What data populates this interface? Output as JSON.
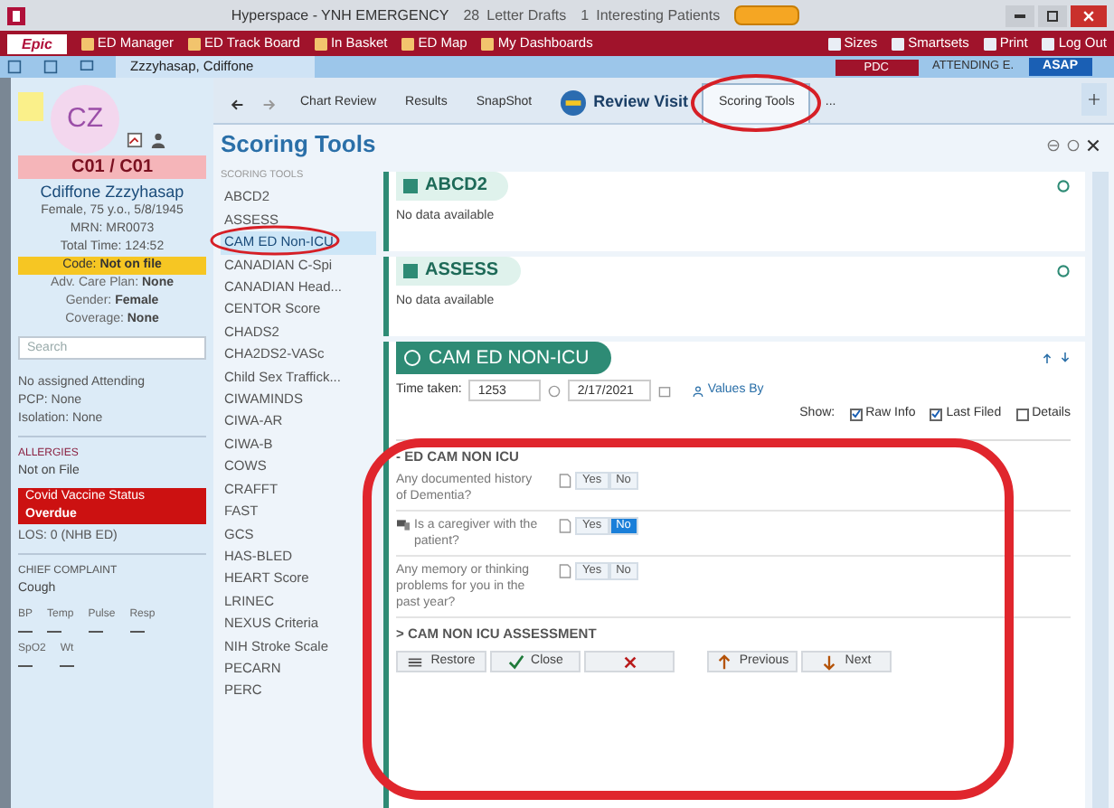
{
  "window": {
    "title": "Hyperspace - YNH EMERGENCY",
    "notices": [
      {
        "count": "28",
        "label": "Letter Drafts"
      },
      {
        "count": "1",
        "label": "Interesting Patients"
      }
    ]
  },
  "toolbar": {
    "logo": "Epic",
    "items": [
      "ED Manager",
      "ED Track Board",
      "In Basket",
      "ED Map",
      "My Dashboards"
    ],
    "right_items": [
      "Sizes",
      "Smartsets",
      "Print",
      "Log Out"
    ]
  },
  "patient_tab": {
    "label": "Zzzyhasap, Cdiffone",
    "badge": "PDC",
    "role": "ATTENDING E.",
    "priority": "ASAP"
  },
  "patient": {
    "initials": "CZ",
    "bed": "C01 / C01",
    "name": "Cdiffone Zzzyhasap",
    "details": [
      "Female, 75 y.o., 5/8/1945",
      "MRN: MR0073",
      "Total Time: 124:52"
    ],
    "code": {
      "label": "Code:",
      "value": "Not on file"
    },
    "facts": [
      {
        "label": "Adv. Care Plan:",
        "value": "None"
      },
      {
        "label": "Gender:",
        "value": "Female"
      },
      {
        "label": "Coverage:",
        "value": "None"
      }
    ],
    "search_placeholder": "Search",
    "care": [
      "No assigned Attending",
      "PCP: None",
      "Isolation: None"
    ],
    "allergies": {
      "title": "ALLERGIES",
      "value": "Not on File"
    },
    "alert": {
      "title": "Covid Vaccine Status",
      "value": "Overdue"
    },
    "los": "LOS: 0 (NHB ED)",
    "complaint": {
      "title": "CHIEF COMPLAINT",
      "value": "Cough"
    },
    "vitals": [
      [
        "BP",
        "Temp",
        "Pulse",
        "Resp"
      ],
      [
        "SpO2",
        "Wt"
      ]
    ]
  },
  "nav_tabs": [
    {
      "label": "Chart Review",
      "selected": false
    },
    {
      "label": "Results",
      "selected": false
    },
    {
      "label": "SnapShot",
      "selected": false
    },
    {
      "label": "Review Visit",
      "selected": false,
      "kind": "big"
    },
    {
      "label": "Scoring Tools",
      "selected": true
    },
    {
      "label": "...",
      "selected": false
    }
  ],
  "scoring": {
    "title": "Scoring Tools",
    "list_heading": "SCORING TOOLS",
    "tools": [
      {
        "label": "ABCD2",
        "selected": false
      },
      {
        "label": "ASSESS",
        "selected": false
      },
      {
        "label": "CAM ED Non-ICU",
        "selected": true
      },
      {
        "label": "CANADIAN C-Spi",
        "selected": false
      },
      {
        "label": "CANADIAN Head...",
        "selected": false
      },
      {
        "label": "CENTOR Score",
        "selected": false
      },
      {
        "label": "CHADS2",
        "selected": false
      },
      {
        "label": "CHA2DS2-VASc",
        "selected": false
      },
      {
        "label": "Child Sex Traffick...",
        "selected": false
      },
      {
        "label": "CIWAMINDS",
        "selected": false
      },
      {
        "label": "CIWA-AR",
        "selected": false
      },
      {
        "label": "CIWA-B",
        "selected": false
      },
      {
        "label": "COWS",
        "selected": false
      },
      {
        "label": "CRAFFT",
        "selected": false
      },
      {
        "label": "FAST",
        "selected": false
      },
      {
        "label": "GCS",
        "selected": false
      },
      {
        "label": "HAS-BLED",
        "selected": false
      },
      {
        "label": "HEART Score",
        "selected": false
      },
      {
        "label": "LRINEC",
        "selected": false
      },
      {
        "label": "NEXUS Criteria",
        "selected": false
      },
      {
        "label": "NIH Stroke Scale",
        "selected": false
      },
      {
        "label": "PECARN",
        "selected": false
      },
      {
        "label": "PERC",
        "selected": false
      }
    ],
    "cards": [
      {
        "title": "ABCD2",
        "message": "No data available"
      },
      {
        "title": "ASSESS",
        "message": "No data available"
      }
    ],
    "form": {
      "title": "CAM ED NON-ICU",
      "time_label": "Time taken:",
      "time": "1253",
      "date": "2/17/2021",
      "values_by": "Values By",
      "show_label": "Show:",
      "options": [
        {
          "label": "Raw Info",
          "checked": true
        },
        {
          "label": "Last Filed",
          "checked": true
        },
        {
          "label": "Details",
          "checked": false
        }
      ],
      "section": "- ED CAM NON ICU",
      "questions": [
        {
          "text": "Any documented history of Dementia?",
          "answers": [
            {
              "label": "Yes",
              "selected": false
            },
            {
              "label": "No",
              "selected": false
            }
          ],
          "commented": false
        },
        {
          "text": "Is a caregiver with the patient?",
          "answers": [
            {
              "label": "Yes",
              "selected": false
            },
            {
              "label": "No",
              "selected": true
            }
          ],
          "commented": true
        },
        {
          "text": "Any memory or thinking problems for you in the past year?",
          "answers": [
            {
              "label": "Yes",
              "selected": false
            },
            {
              "label": "No",
              "selected": false
            }
          ],
          "commented": false
        }
      ],
      "collapsed_section": "> CAM NON ICU ASSESSMENT",
      "buttons": [
        {
          "label": "Restore",
          "kind": "restore"
        },
        {
          "label": "Close",
          "kind": "close"
        },
        {
          "kind": "cancel"
        },
        {
          "label": "Previous",
          "kind": "previous"
        },
        {
          "label": "Next",
          "kind": "next"
        }
      ]
    }
  }
}
